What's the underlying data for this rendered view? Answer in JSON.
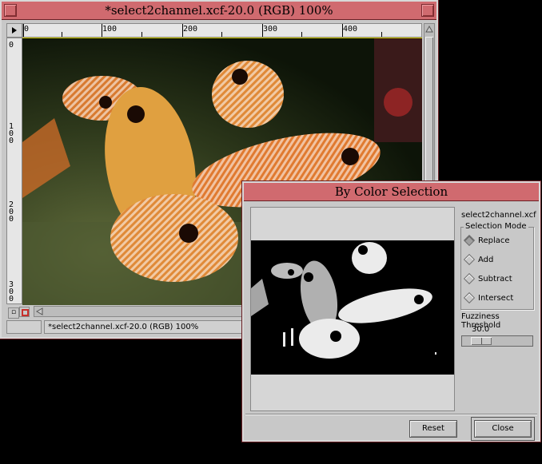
{
  "image_window": {
    "title": "*select2channel.xcf-20.0 (RGB) 100%",
    "status_text": "*select2channel.xcf-20.0 (RGB) 100%",
    "ruler_h_labels": [
      "0",
      "100",
      "200",
      "300",
      "400"
    ],
    "ruler_v_labels": [
      "0",
      "100",
      "200",
      "300"
    ]
  },
  "dialog": {
    "title": "By Color Selection",
    "filename": "select2channel.xcf",
    "selection_mode": {
      "legend": "Selection Mode",
      "options": [
        "Replace",
        "Add",
        "Subtract",
        "Intersect"
      ],
      "selected": "Replace"
    },
    "fuzziness": {
      "label": "Fuzziness Threshold",
      "value": "30.0"
    },
    "buttons": {
      "reset": "Reset",
      "close": "Close"
    }
  },
  "colors": {
    "titlebar": "#d06a6f",
    "window_bg": "#c8c8c8",
    "desktop": "#000000",
    "fish": "#e08a38",
    "selection_highlight": "#ffffff"
  }
}
